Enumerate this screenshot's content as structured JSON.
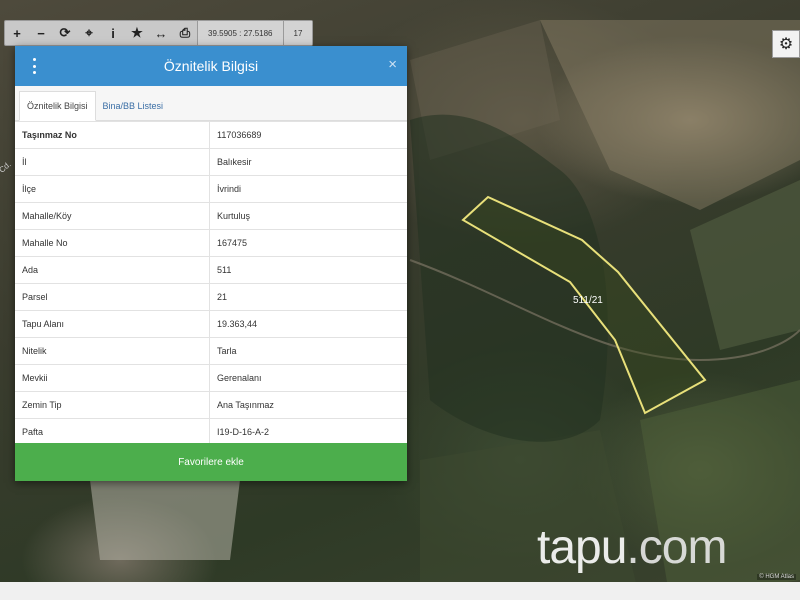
{
  "toolbar": {
    "buttons": [
      {
        "name": "zoom-in-button",
        "glyph": "+"
      },
      {
        "name": "zoom-out-button",
        "glyph": "−"
      },
      {
        "name": "refresh-button",
        "glyph": "⟳"
      },
      {
        "name": "locate-button",
        "glyph": "⌖"
      },
      {
        "name": "info-button",
        "glyph": "i"
      },
      {
        "name": "favorite-button",
        "glyph": "★"
      },
      {
        "name": "measure-button",
        "glyph": "↔"
      },
      {
        "name": "print-button",
        "glyph": "⎙"
      }
    ],
    "coordinates": "39.5905 : 27.5186",
    "zoom": "17"
  },
  "panel": {
    "title": "Öznitelik Bilgisi",
    "close": "×",
    "tabs": [
      "Öznitelik Bilgisi",
      "Bina/BB Listesi"
    ],
    "rows": [
      {
        "key": "Taşınmaz No",
        "value": "117036689"
      },
      {
        "key": "İl",
        "value": "Balıkesir"
      },
      {
        "key": "İlçe",
        "value": "İvrindi"
      },
      {
        "key": "Mahalle/Köy",
        "value": "Kurtuluş"
      },
      {
        "key": "Mahalle No",
        "value": "167475"
      },
      {
        "key": "Ada",
        "value": "511"
      },
      {
        "key": "Parsel",
        "value": "21"
      },
      {
        "key": "Tapu Alanı",
        "value": "19.363,44"
      },
      {
        "key": "Nitelik",
        "value": "Tarla"
      },
      {
        "key": "Mevkii",
        "value": "Gerenalanı"
      },
      {
        "key": "Zemin Tip",
        "value": "Ana Taşınmaz"
      },
      {
        "key": "Pafta",
        "value": "I19-D-16-A-2"
      }
    ],
    "favorite_label": "Favorilere ekle"
  },
  "map": {
    "parcel_label": "511/21",
    "road_label": "Cd.",
    "parcel_outline_color": "#e8e07a"
  },
  "brand": {
    "name": "tapu",
    "suffix": ".com"
  },
  "copyright": "© HGM Atlas"
}
